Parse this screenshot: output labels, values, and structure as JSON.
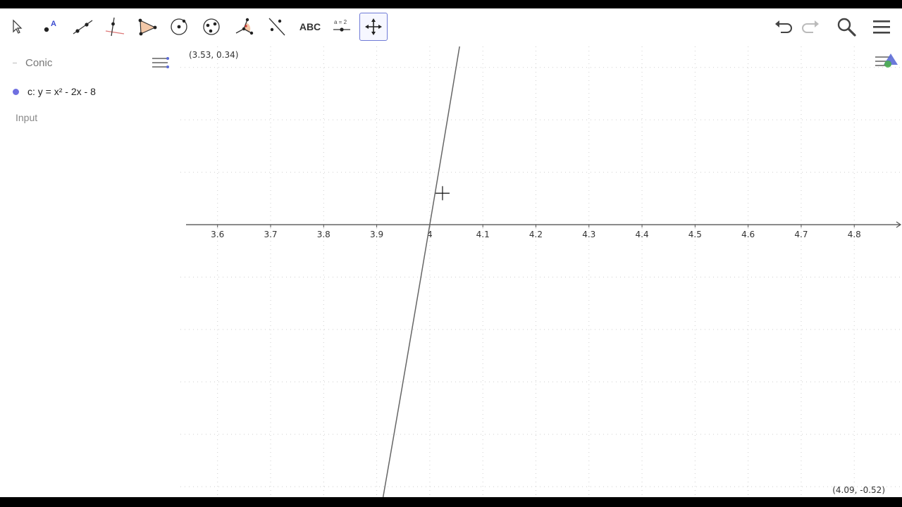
{
  "toolbar": {
    "tools": [
      {
        "name": "move-tool",
        "icon": "arrow-cursor-icon"
      },
      {
        "name": "point-tool",
        "icon": "point-a-icon"
      },
      {
        "name": "line-tool",
        "icon": "line-through-points-icon"
      },
      {
        "name": "perpendicular-line-tool",
        "icon": "perpendicular-icon"
      },
      {
        "name": "polygon-tool",
        "icon": "polygon-icon"
      },
      {
        "name": "circle-tool",
        "icon": "circle-center-icon"
      },
      {
        "name": "circle-three-points-tool",
        "icon": "circle-three-points-icon"
      },
      {
        "name": "angle-tool",
        "icon": "angle-icon"
      },
      {
        "name": "reflect-tool",
        "icon": "reflect-line-icon"
      },
      {
        "name": "text-tool",
        "icon": "text-icon",
        "label": "ABC"
      },
      {
        "name": "slider-tool",
        "icon": "slider-icon",
        "label": "a = 2"
      },
      {
        "name": "move-graphics-view-tool",
        "icon": "move-view-icon",
        "active": true
      }
    ],
    "undo_icon": "undo-icon",
    "redo_icon": "redo-icon",
    "search_icon": "search-icon",
    "menu_icon": "menu-icon"
  },
  "algebra": {
    "header_label": "Conic",
    "items": [
      {
        "label": "c: y = x² - 2x - 8",
        "color": "#6f6fe0"
      }
    ],
    "input_label": "Input"
  },
  "graphics": {
    "coord_top_left": "(3.53, 0.34)",
    "coord_bottom_right": "(4.09, -0.52)",
    "x_ticks": [
      "3.6",
      "3.7",
      "3.8",
      "3.9",
      "4",
      "4.1",
      "4.2",
      "4.3",
      "4.4",
      "4.5",
      "4.6",
      "4.7",
      "4.8"
    ],
    "view": {
      "xmin": 3.53,
      "xmax": 4.89,
      "ymin": -0.52,
      "ymax": 0.34
    },
    "function": {
      "a": 1,
      "b": -2,
      "c": -8
    },
    "colors": {
      "axis": "#555555",
      "grid": "#cfcfcf",
      "curve": "#666666"
    }
  }
}
